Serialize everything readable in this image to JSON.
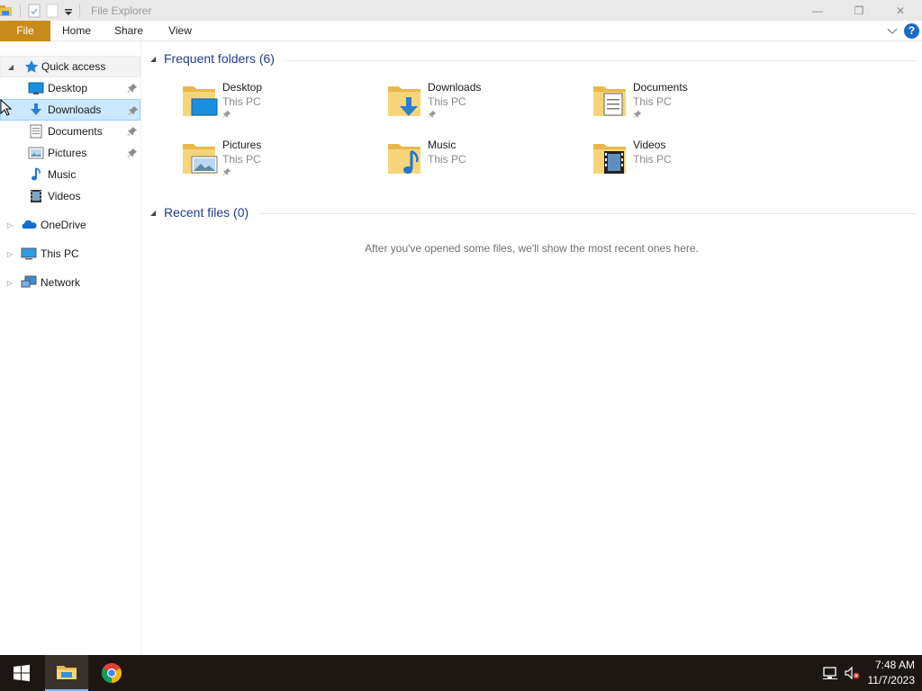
{
  "window": {
    "title": "File Explorer",
    "controls": {
      "minimize": "—",
      "restore": "❐",
      "close": "✕"
    }
  },
  "ribbon": {
    "tabs": [
      {
        "label": "File"
      },
      {
        "label": "Home"
      },
      {
        "label": "Share"
      },
      {
        "label": "View"
      }
    ],
    "help": "?"
  },
  "nav": {
    "quick_access": "Quick access",
    "quick_items": [
      {
        "label": "Desktop",
        "icon": "desktop-icon",
        "pinned": true
      },
      {
        "label": "Downloads",
        "icon": "downloads-icon",
        "pinned": true
      },
      {
        "label": "Documents",
        "icon": "documents-icon",
        "pinned": true
      },
      {
        "label": "Pictures",
        "icon": "pictures-icon",
        "pinned": true
      },
      {
        "label": "Music",
        "icon": "music-icon",
        "pinned": false
      },
      {
        "label": "Videos",
        "icon": "videos-icon",
        "pinned": false
      }
    ],
    "roots": [
      {
        "label": "OneDrive",
        "icon": "onedrive-icon"
      },
      {
        "label": "This PC",
        "icon": "this-pc-icon"
      },
      {
        "label": "Network",
        "icon": "network-icon"
      }
    ]
  },
  "content": {
    "frequent_header": "Frequent folders (6)",
    "folders": [
      {
        "name": "Desktop",
        "location": "This PC",
        "pinned": true
      },
      {
        "name": "Downloads",
        "location": "This PC",
        "pinned": true
      },
      {
        "name": "Documents",
        "location": "This PC",
        "pinned": true
      },
      {
        "name": "Pictures",
        "location": "This PC",
        "pinned": true
      },
      {
        "name": "Music",
        "location": "This PC",
        "pinned": false
      },
      {
        "name": "Videos",
        "location": "This PC",
        "pinned": false
      }
    ],
    "recent_header": "Recent files (0)",
    "recent_empty": "After you've opened some files, we'll show the most recent ones here."
  },
  "taskbar": {
    "time": "7:48 AM",
    "date": "11/7/2023"
  },
  "colors": {
    "file_tab": "#c98a1c",
    "selection": "#cce8ff",
    "header_blue": "#1e3c8c",
    "taskbar": "#1c1713"
  }
}
